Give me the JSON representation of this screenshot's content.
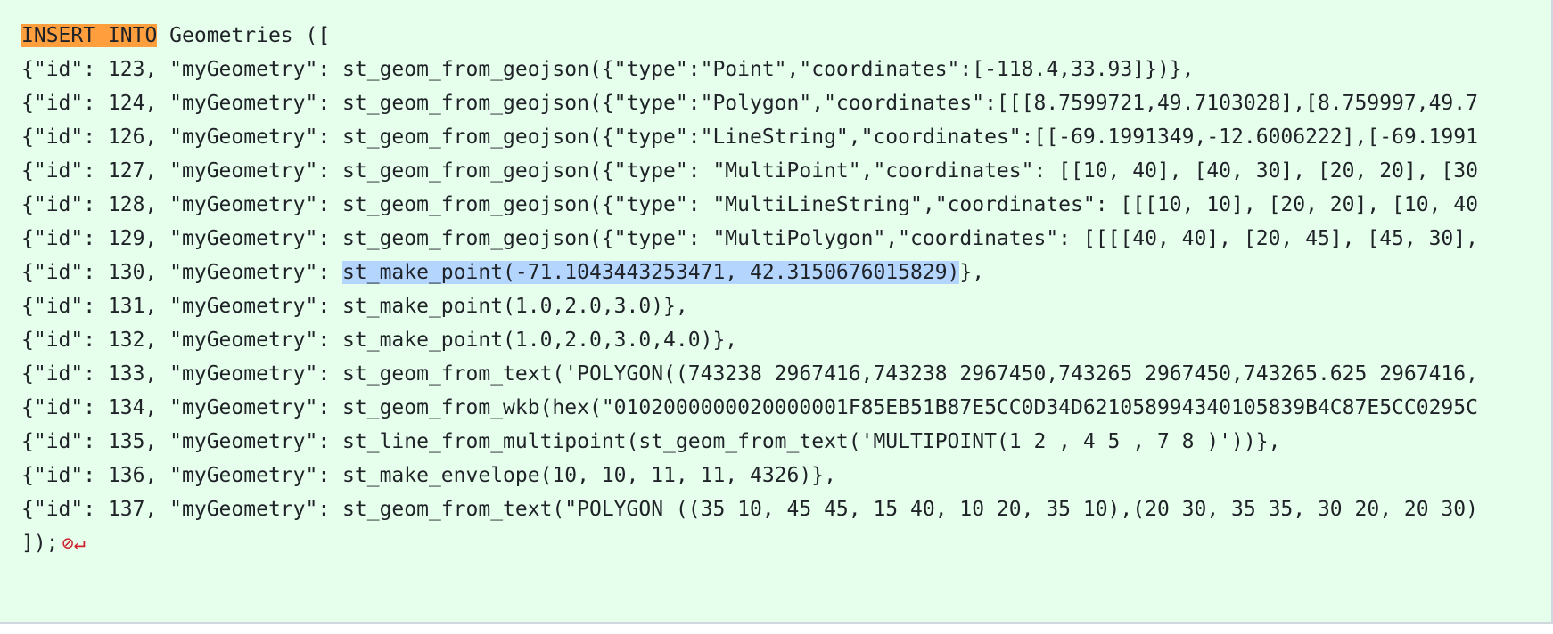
{
  "code": {
    "header": {
      "keyword": "INSERT INTO",
      "rest": " Geometries (["
    },
    "lines": [
      "{\"id\": 123, \"myGeometry\": st_geom_from_geojson({\"type\":\"Point\",\"coordinates\":[-118.4,33.93]})},",
      "{\"id\": 124, \"myGeometry\": st_geom_from_geojson({\"type\":\"Polygon\",\"coordinates\":[[[8.7599721,49.7103028],[8.759997,49.7",
      "{\"id\": 126, \"myGeometry\": st_geom_from_geojson({\"type\":\"LineString\",\"coordinates\":[[-69.1991349,-12.6006222],[-69.1991",
      "{\"id\": 127, \"myGeometry\": st_geom_from_geojson({\"type\": \"MultiPoint\",\"coordinates\": [[10, 40], [40, 30], [20, 20], [30",
      "{\"id\": 128, \"myGeometry\": st_geom_from_geojson({\"type\": \"MultiLineString\",\"coordinates\": [[[10, 10], [20, 20], [10, 40",
      "{\"id\": 129, \"myGeometry\": st_geom_from_geojson({\"type\": \"MultiPolygon\",\"coordinates\": [[[[40, 40], [20, 45], [45, 30],"
    ],
    "selected_line": {
      "prefix": "{\"id\": 130, \"myGeometry\": ",
      "selected": "st_make_point(-71.1043443253471, 42.3150676015829)",
      "suffix": "},"
    },
    "lines_after": [
      "{\"id\": 131, \"myGeometry\": st_make_point(1.0,2.0,3.0)},",
      "{\"id\": 132, \"myGeometry\": st_make_point(1.0,2.0,3.0,4.0)},",
      "{\"id\": 133, \"myGeometry\": st_geom_from_text('POLYGON((743238 2967416,743238 2967450,743265 2967450,743265.625 2967416,",
      "{\"id\": 134, \"myGeometry\": st_geom_from_wkb(hex(\"0102000000020000001F85EB51B87E5CC0D34D621058994340105839B4C87E5CC0295C",
      "{\"id\": 135, \"myGeometry\": st_line_from_multipoint(st_geom_from_text('MULTIPOINT(1 2 , 4 5 , 7 8 )'))},",
      "{\"id\": 136, \"myGeometry\": st_make_envelope(10, 10, 11, 11, 4326)},",
      "{\"id\": 137, \"myGeometry\": st_geom_from_text(\"POLYGON ((35 10, 45 45, 15 40, 10 20, 35 10),(20 30, 35 35, 30 20, 20 30)"
    ],
    "footer": "]);",
    "footer_icon": "no-newline-at-eof-icon",
    "footer_icon_glyph": "⊘↵"
  },
  "colors": {
    "background": "#e6ffec",
    "keyword_highlight": "#ff9e3d",
    "selection_highlight": "#b4d5fe",
    "marker": "#cf222e"
  }
}
